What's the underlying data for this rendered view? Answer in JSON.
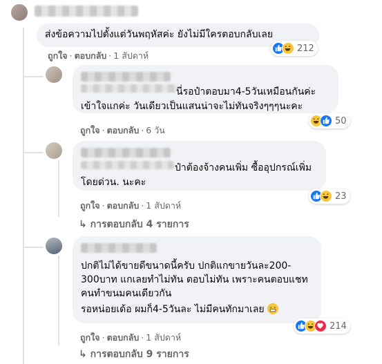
{
  "comments": [
    {
      "text": "ส่งข้อความไปตั้งแต่วันพฤหัสค่ะ ยังไม่มีใครตอบกลับเลย",
      "like_label": "ถูกใจ",
      "reply_label": "ตอบกลับ",
      "time": "1 สัปดาห์",
      "reaction_count": "212",
      "reactions": [
        "like-icon",
        "haha-icon"
      ]
    },
    {
      "line1": "นี่รอป๋าตอบมา4-5วันเหมือนกันค่ะ",
      "line2": "เข้าใจแกค่ะ วันเดียวเป็นแสนน่าจะไม่ทันจริงๆๆๆนะคะ",
      "like_label": "ถูกใจ",
      "reply_label": "ตอบกลับ",
      "time": "6 วัน",
      "reaction_count": "50",
      "reactions": [
        "haha-icon",
        "like-icon"
      ]
    },
    {
      "line1": "ป๋าต้องจ้างคนเพิ่ม ซื้ออุปกรณ์เพิ่ม",
      "line2": "โดยด่วน. นะคะ",
      "like_label": "ถูกใจ",
      "reply_label": "ตอบกลับ",
      "time": "1 สัปดาห์",
      "reaction_count": "23",
      "reactions": [
        "like-icon",
        "haha-icon"
      ],
      "replies_label": "การตอบกลับ 4 รายการ"
    },
    {
      "line1": "ปกติไม่ได้ขายดีขนาดนี้ครับ ปกติแกขายวันละ200-",
      "line2": "300บาท แกเลยทำไม่ทัน ตอบไม่ทัน เพราะคนตอบแชท",
      "line3": "คนทำขนมคนเดียวกัน",
      "line4": "รอหน่อยเด้อ ผมก็4-5วันละ ไม่มีคนทักมาเลย",
      "like_label": "ถูกใจ",
      "reply_label": "ตอบกลับ",
      "time": "1 สัปดาห์",
      "reaction_count": "214",
      "reactions": [
        "like-icon",
        "haha-icon",
        "love-icon"
      ],
      "replies_label": "การตอบกลับ 9 รายการ"
    }
  ],
  "colors": {
    "bubble": "#f0f2f5",
    "meta_text": "#65676b",
    "like": "#1877f2",
    "haha": "#f7c63d",
    "love": "#f02849"
  }
}
